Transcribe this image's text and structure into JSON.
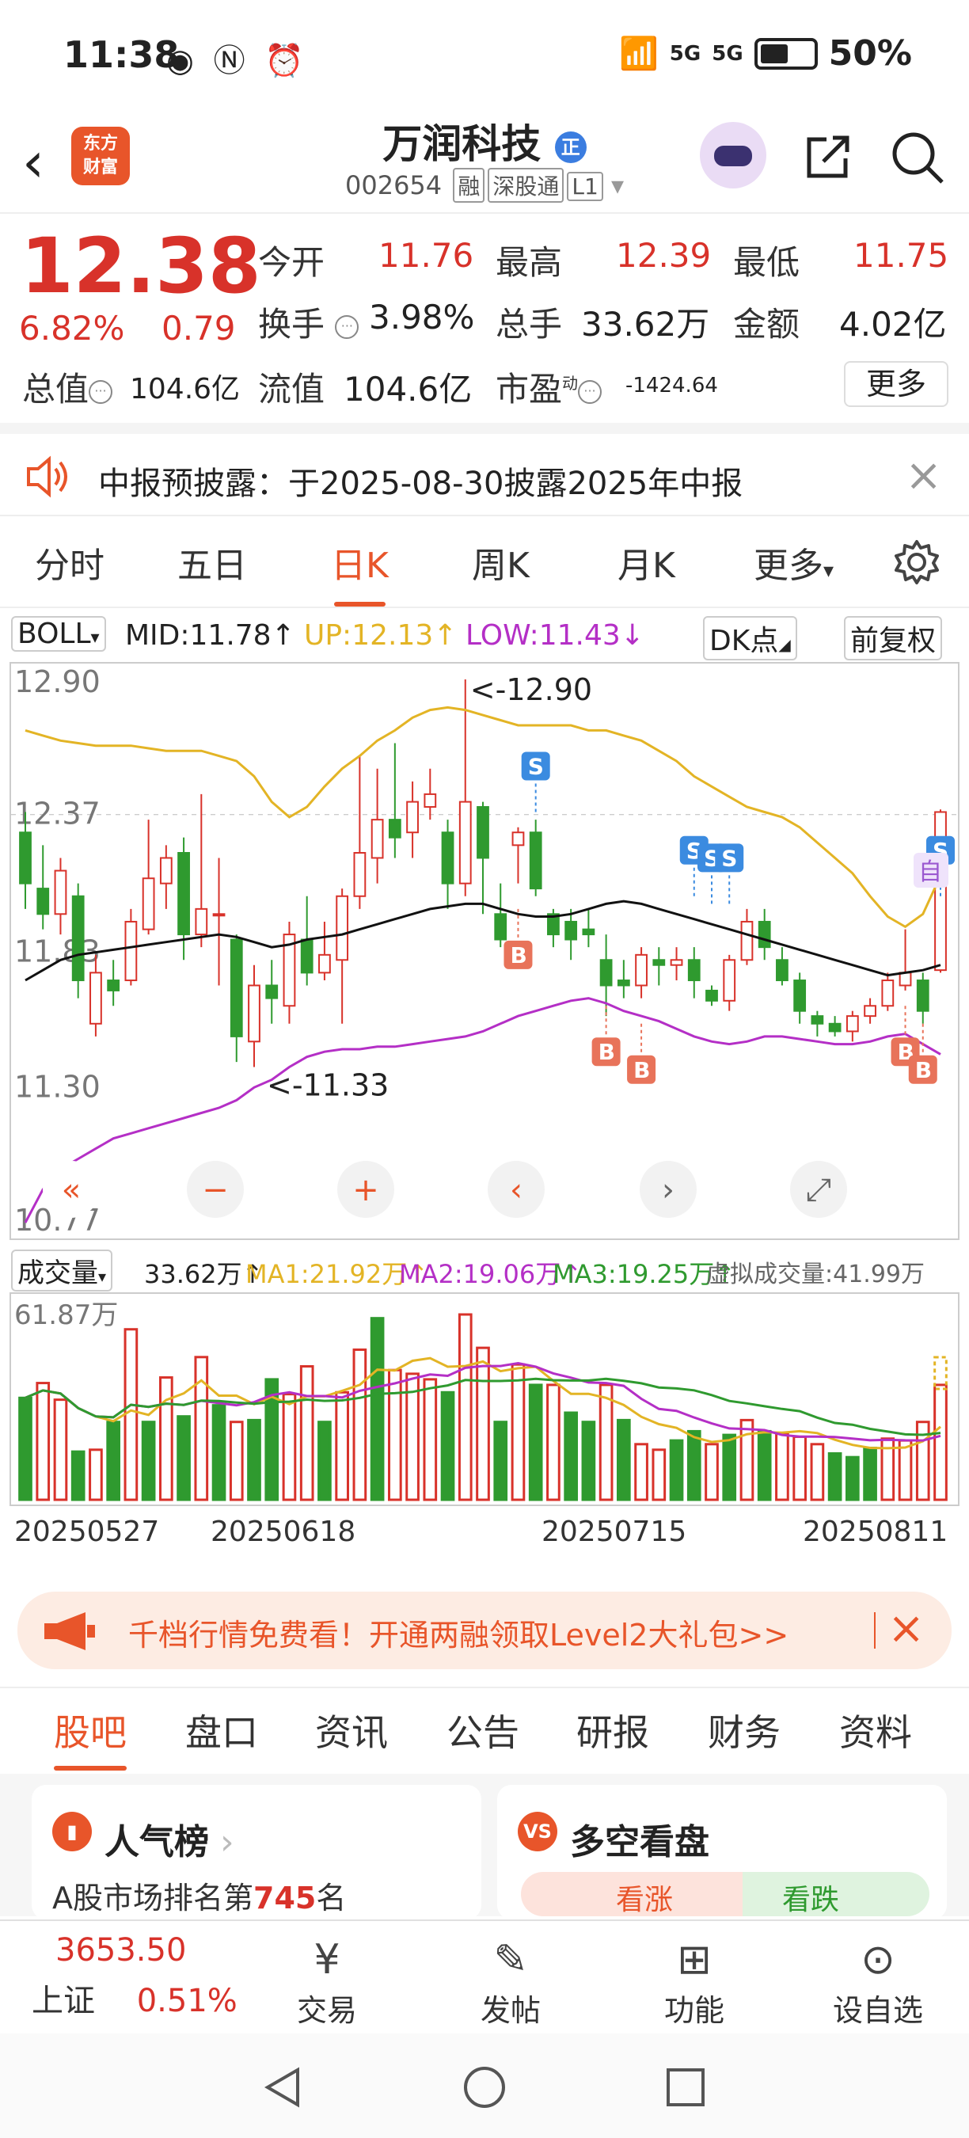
{
  "status": {
    "time": "11:38",
    "signal": "5G",
    "signal2": "5G",
    "battery": "50%"
  },
  "header": {
    "logo_text1": "东方",
    "logo_text2": "财富",
    "stock_name": "万润科技",
    "name_badge": "正",
    "code": "002654",
    "tags": [
      "融",
      "深股通",
      "L1"
    ]
  },
  "quote": {
    "price": "12.38",
    "change_pct": "6.82%",
    "change_abs": "0.79",
    "open_label": "今开",
    "open": "11.76",
    "high_label": "最高",
    "high": "12.39",
    "low_label": "最低",
    "low": "11.75",
    "turnover_label": "换手",
    "turnover": "3.98%",
    "volume_label": "总手",
    "volume": "33.62万",
    "amount_label": "金额",
    "amount": "4.02亿",
    "mktcap_label": "总值",
    "mktcap": "104.6亿",
    "float_label": "流值",
    "float": "104.6亿",
    "pe_label": "市盈",
    "pe_sup": "动",
    "pe": "-1424.64",
    "more": "更多"
  },
  "notice": {
    "text": "中报预披露：于2025-08-30披露2025年中报"
  },
  "ktabs": [
    "分时",
    "五日",
    "日K",
    "周K",
    "月K",
    "更多"
  ],
  "ktabs_active": 2,
  "indicator": {
    "name": "BOLL",
    "mid": "MID:11.78↑",
    "up": "UP:12.13↑",
    "low": "LOW:11.43↓",
    "dk": "DK点",
    "adjust": "前复权"
  },
  "chart_data": {
    "type": "candlestick",
    "y_labels": [
      "12.90",
      "12.37",
      "11.83",
      "11.30",
      "10.77"
    ],
    "ylim": [
      10.77,
      12.9
    ],
    "annot_high": "<-12.90",
    "annot_low": "<-11.33",
    "self_tag": "自",
    "signal_b": "B",
    "signal_s": "S",
    "candles": [
      {
        "o": 12.3,
        "c": 12.1,
        "h": 12.38,
        "l": 12.0
      },
      {
        "o": 12.08,
        "c": 11.98,
        "h": 12.25,
        "l": 11.92
      },
      {
        "o": 11.98,
        "c": 12.15,
        "h": 12.2,
        "l": 11.9
      },
      {
        "o": 12.05,
        "c": 11.72,
        "h": 12.1,
        "l": 11.65
      },
      {
        "o": 11.55,
        "c": 11.75,
        "h": 11.82,
        "l": 11.5
      },
      {
        "o": 11.72,
        "c": 11.68,
        "h": 11.8,
        "l": 11.62
      },
      {
        "o": 11.72,
        "c": 11.95,
        "h": 12.0,
        "l": 11.7
      },
      {
        "o": 11.92,
        "c": 12.12,
        "h": 12.35,
        "l": 11.9
      },
      {
        "o": 12.1,
        "c": 12.2,
        "h": 12.25,
        "l": 12.0
      },
      {
        "o": 12.22,
        "c": 11.9,
        "h": 12.28,
        "l": 11.8
      },
      {
        "o": 11.9,
        "c": 12.0,
        "h": 12.45,
        "l": 11.85
      },
      {
        "o": 11.98,
        "c": 11.98,
        "h": 12.2,
        "l": 11.7
      },
      {
        "o": 11.88,
        "c": 11.5,
        "h": 11.9,
        "l": 11.4
      },
      {
        "o": 11.48,
        "c": 11.7,
        "h": 11.78,
        "l": 11.38
      },
      {
        "o": 11.7,
        "c": 11.65,
        "h": 11.8,
        "l": 11.55
      },
      {
        "o": 11.62,
        "c": 11.9,
        "h": 11.95,
        "l": 11.55
      },
      {
        "o": 11.88,
        "c": 11.75,
        "h": 12.05,
        "l": 11.7
      },
      {
        "o": 11.75,
        "c": 11.82,
        "h": 11.95,
        "l": 11.72
      },
      {
        "o": 11.8,
        "c": 12.05,
        "h": 12.08,
        "l": 11.55
      },
      {
        "o": 12.05,
        "c": 12.22,
        "h": 12.6,
        "l": 12.0
      },
      {
        "o": 12.2,
        "c": 12.35,
        "h": 12.55,
        "l": 12.1
      },
      {
        "o": 12.35,
        "c": 12.28,
        "h": 12.65,
        "l": 12.2
      },
      {
        "o": 12.3,
        "c": 12.42,
        "h": 12.5,
        "l": 12.2
      },
      {
        "o": 12.4,
        "c": 12.45,
        "h": 12.55,
        "l": 12.35
      },
      {
        "o": 12.3,
        "c": 12.1,
        "h": 12.35,
        "l": 12.0
      },
      {
        "o": 12.1,
        "c": 12.42,
        "h": 12.9,
        "l": 12.05
      },
      {
        "o": 12.4,
        "c": 12.2,
        "h": 12.42,
        "l": 11.98
      },
      {
        "o": 11.98,
        "c": 11.88,
        "h": 12.1,
        "l": 11.85
      },
      {
        "o": 12.25,
        "c": 12.3,
        "h": 12.32,
        "l": 12.1
      },
      {
        "o": 12.3,
        "c": 12.08,
        "h": 12.35,
        "l": 12.05
      },
      {
        "o": 11.98,
        "c": 11.9,
        "h": 12.0,
        "l": 11.85
      },
      {
        "o": 11.95,
        "c": 11.88,
        "h": 12.0,
        "l": 11.8
      },
      {
        "o": 11.92,
        "c": 11.9,
        "h": 12.0,
        "l": 11.85
      },
      {
        "o": 11.8,
        "c": 11.7,
        "h": 11.9,
        "l": 11.58
      },
      {
        "o": 11.72,
        "c": 11.7,
        "h": 11.8,
        "l": 11.65
      },
      {
        "o": 11.7,
        "c": 11.82,
        "h": 11.85,
        "l": 11.65
      },
      {
        "o": 11.8,
        "c": 11.78,
        "h": 11.85,
        "l": 11.7
      },
      {
        "o": 11.78,
        "c": 11.8,
        "h": 11.85,
        "l": 11.72
      },
      {
        "o": 11.8,
        "c": 11.72,
        "h": 11.85,
        "l": 11.65
      },
      {
        "o": 11.68,
        "c": 11.64,
        "h": 11.7,
        "l": 11.62
      },
      {
        "o": 11.64,
        "c": 11.8,
        "h": 11.82,
        "l": 11.6
      },
      {
        "o": 11.8,
        "c": 11.95,
        "h": 12.0,
        "l": 11.78
      },
      {
        "o": 11.95,
        "c": 11.85,
        "h": 12.0,
        "l": 11.8
      },
      {
        "o": 11.8,
        "c": 11.72,
        "h": 11.85,
        "l": 11.7
      },
      {
        "o": 11.72,
        "c": 11.6,
        "h": 11.75,
        "l": 11.55
      },
      {
        "o": 11.58,
        "c": 11.55,
        "h": 11.6,
        "l": 11.5
      },
      {
        "o": 11.55,
        "c": 11.52,
        "h": 11.58,
        "l": 11.5
      },
      {
        "o": 11.52,
        "c": 11.58,
        "h": 11.6,
        "l": 11.48
      },
      {
        "o": 11.58,
        "c": 11.62,
        "h": 11.65,
        "l": 11.55
      },
      {
        "o": 11.62,
        "c": 11.72,
        "h": 11.75,
        "l": 11.6
      },
      {
        "o": 11.7,
        "c": 11.75,
        "h": 11.92,
        "l": 11.68
      },
      {
        "o": 11.72,
        "c": 11.6,
        "h": 11.75,
        "l": 11.55
      },
      {
        "o": 11.76,
        "c": 12.38,
        "h": 12.39,
        "l": 11.75
      }
    ],
    "mid": [
      11.72,
      11.76,
      11.8,
      11.82,
      11.83,
      11.84,
      11.85,
      11.86,
      11.87,
      11.88,
      11.89,
      11.9,
      11.89,
      11.87,
      11.85,
      11.86,
      11.88,
      11.89,
      11.9,
      11.92,
      11.94,
      11.96,
      11.98,
      12.0,
      12.01,
      12.02,
      12.02,
      12.0,
      11.98,
      11.97,
      11.97,
      11.98,
      12.0,
      12.02,
      12.03,
      12.02,
      12.0,
      11.98,
      11.96,
      11.94,
      11.92,
      11.9,
      11.88,
      11.86,
      11.84,
      11.82,
      11.8,
      11.78,
      11.76,
      11.74,
      11.75,
      11.76,
      11.78
    ],
    "up": [
      12.7,
      12.68,
      12.66,
      12.65,
      12.64,
      12.64,
      12.64,
      12.63,
      12.62,
      12.62,
      12.62,
      12.6,
      12.58,
      12.52,
      12.42,
      12.36,
      12.4,
      12.48,
      12.55,
      12.6,
      12.66,
      12.7,
      12.75,
      12.78,
      12.79,
      12.78,
      12.76,
      12.74,
      12.72,
      12.72,
      12.72,
      12.72,
      12.7,
      12.7,
      12.68,
      12.66,
      12.62,
      12.58,
      12.52,
      12.48,
      12.44,
      12.4,
      12.38,
      12.36,
      12.32,
      12.26,
      12.2,
      12.14,
      12.05,
      11.97,
      11.93,
      11.98,
      12.13
    ],
    "low": [
      10.77,
      10.9,
      10.98,
      11.02,
      11.06,
      11.1,
      11.12,
      11.14,
      11.16,
      11.18,
      11.2,
      11.22,
      11.25,
      11.3,
      11.33,
      11.38,
      11.42,
      11.44,
      11.45,
      11.45,
      11.46,
      11.46,
      11.47,
      11.48,
      11.49,
      11.5,
      11.52,
      11.55,
      11.58,
      11.6,
      11.62,
      11.64,
      11.65,
      11.63,
      11.6,
      11.58,
      11.56,
      11.53,
      11.5,
      11.48,
      11.47,
      11.48,
      11.5,
      11.5,
      11.49,
      11.48,
      11.47,
      11.47,
      11.48,
      11.5,
      11.51,
      11.47,
      11.43
    ]
  },
  "chart_controls": [
    "«",
    "−",
    "+",
    "‹",
    "›",
    "⤢"
  ],
  "volume": {
    "name": "成交量",
    "vol": "33.62万↑",
    "ma1": "MA1:21.92万↑",
    "ma2": "MA2:19.06万↑",
    "ma3": "MA3:19.25万↑",
    "virtual": "虚拟成交量:41.99万",
    "max_label": "61.87万",
    "bars": [
      0.55,
      0.63,
      0.54,
      0.26,
      0.27,
      0.42,
      0.92,
      0.42,
      0.66,
      0.45,
      0.77,
      0.51,
      0.42,
      0.43,
      0.65,
      0.57,
      0.72,
      0.42,
      0.58,
      0.81,
      0.98,
      0.7,
      0.68,
      0.65,
      0.58,
      1.0,
      0.82,
      0.42,
      0.73,
      0.62,
      0.62,
      0.47,
      0.42,
      0.62,
      0.43,
      0.3,
      0.27,
      0.32,
      0.37,
      0.3,
      0.35,
      0.43,
      0.37,
      0.36,
      0.34,
      0.3,
      0.25,
      0.23,
      0.28,
      0.33,
      0.32,
      0.42,
      0.62
    ],
    "up": [
      0,
      1,
      1,
      0,
      1,
      0,
      1,
      0,
      1,
      0,
      1,
      0,
      1,
      0,
      0,
      1,
      1,
      0,
      1,
      1,
      0,
      1,
      1,
      1,
      0,
      1,
      1,
      0,
      1,
      0,
      1,
      0,
      0,
      1,
      0,
      1,
      1,
      0,
      0,
      1,
      0,
      1,
      0,
      1,
      1,
      1,
      0,
      0,
      0,
      1,
      1,
      1,
      1
    ]
  },
  "dates": [
    "20250527",
    "20250618",
    "20250715",
    "20250811"
  ],
  "promo": {
    "text": "千档行情免费看！开通两融领取Level2大礼包>>"
  },
  "btabs": [
    "股吧",
    "盘口",
    "资讯",
    "公告",
    "研报",
    "财务",
    "资料"
  ],
  "cards": {
    "left_title": "人气榜",
    "left_sub_prefix": "A股市场排名第",
    "left_rank": "745",
    "left_sub_suffix": "名",
    "right_title": "多空看盘",
    "right_up": "看涨",
    "right_down": "看跌"
  },
  "nav": {
    "index_value": "3653.50",
    "index_name": "上证",
    "index_change": "0.51%",
    "items": [
      "交易",
      "发帖",
      "功能",
      "设自选"
    ]
  },
  "colors": {
    "red": "#d8322a",
    "green": "#2f9a2f",
    "accent": "#e8552a",
    "mid": "#111111",
    "up": "#e3b425",
    "low": "#b42fc6"
  }
}
